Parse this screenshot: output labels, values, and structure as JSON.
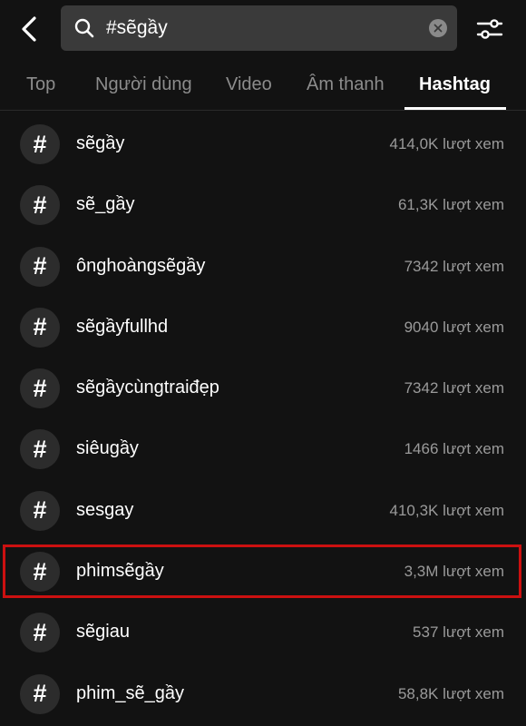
{
  "header": {
    "back_icon": "chevron-left-icon",
    "search_icon": "search-icon",
    "search_value": "#sẽgầy",
    "clear_icon": "clear-icon",
    "filter_icon": "filter-sliders-icon"
  },
  "tabs": [
    {
      "label": "Top",
      "active": false
    },
    {
      "label": "Người dùng",
      "active": false
    },
    {
      "label": "Video",
      "active": false
    },
    {
      "label": "Âm thanh",
      "active": false
    },
    {
      "label": "Hashtag",
      "active": true
    }
  ],
  "hashtags": [
    {
      "symbol": "#",
      "name": "sẽgầy",
      "views": "414,0K lượt xem"
    },
    {
      "symbol": "#",
      "name": "sẽ_gầy",
      "views": "61,3K lượt xem"
    },
    {
      "symbol": "#",
      "name": "ônghoàngsẽgầy",
      "views": "7342 lượt xem"
    },
    {
      "symbol": "#",
      "name": "sẽgầyfullhd",
      "views": "9040 lượt xem"
    },
    {
      "symbol": "#",
      "name": "sẽgầycùngtraiđẹp",
      "views": "7342 lượt xem"
    },
    {
      "symbol": "#",
      "name": "siêugầy",
      "views": "1466 lượt xem"
    },
    {
      "symbol": "#",
      "name": "sesgay",
      "views": "410,3K lượt xem"
    },
    {
      "symbol": "#",
      "name": "phimsẽgầy",
      "views": "3,3M lượt xem"
    },
    {
      "symbol": "#",
      "name": "sẽgiau",
      "views": "537 lượt xem"
    },
    {
      "symbol": "#",
      "name": "phim_sẽ_gầy",
      "views": "58,8K lượt xem"
    }
  ],
  "colors": {
    "background": "#121212",
    "highlight_border": "#cc1010",
    "muted_text": "#9a9a9a"
  }
}
